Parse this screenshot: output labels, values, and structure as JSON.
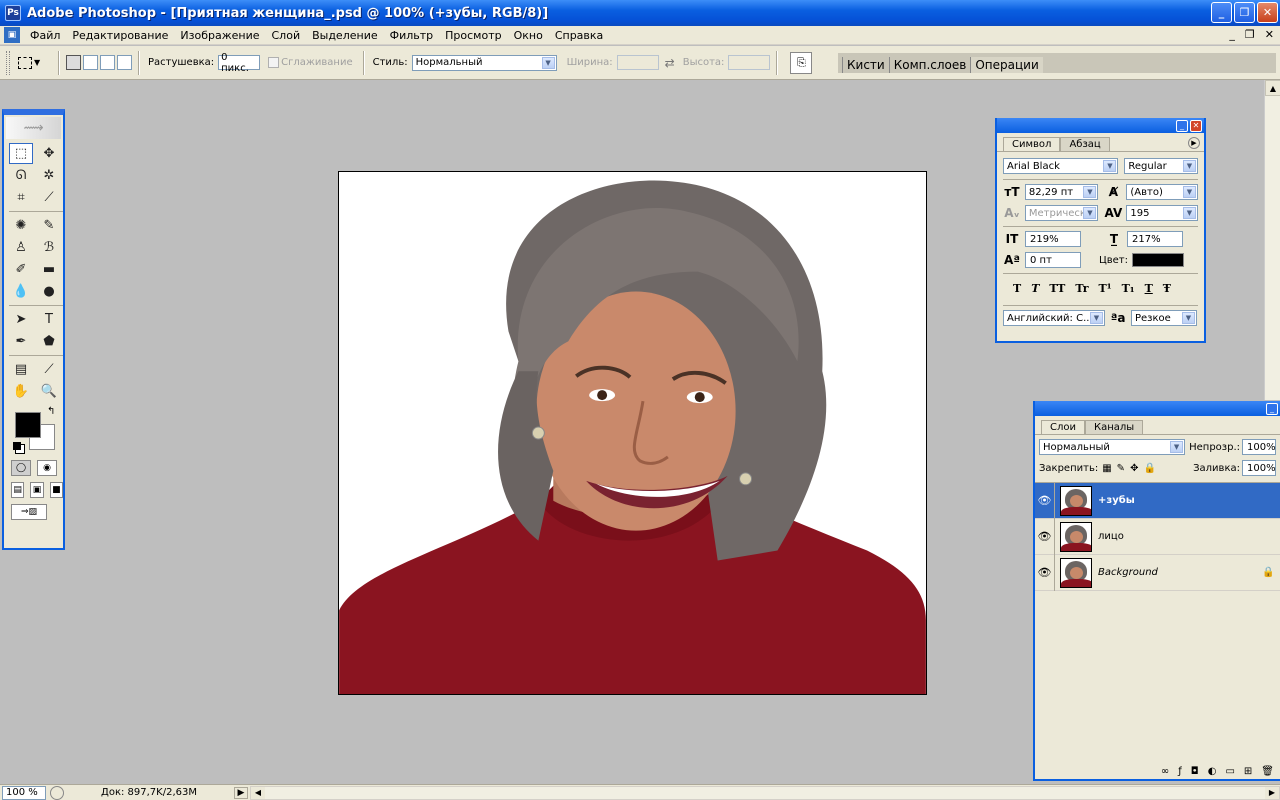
{
  "window": {
    "title": "Adobe Photoshop - [Приятная женщина_.psd @ 100% (+зубы, RGB/8)]",
    "app_icon": "Ps",
    "buttons": {
      "minimize": "_",
      "restore": "❐",
      "close": "✕"
    }
  },
  "menu": {
    "items": [
      "Файл",
      "Редактирование",
      "Изображение",
      "Слой",
      "Выделение",
      "Фильтр",
      "Просмотр",
      "Окно",
      "Справка"
    ],
    "doc_controls": [
      "_",
      "❐",
      "✕"
    ]
  },
  "options": {
    "feather_label": "Растушевка:",
    "feather_value": "0 пикс.",
    "antialias_label": "Сглаживание",
    "style_label": "Стиль:",
    "style_value": "Нормальный",
    "width_label": "Ширина:",
    "height_label": "Высота:"
  },
  "palette_well": {
    "tabs": [
      "Кисти",
      "Комп.слоев",
      "Операции"
    ]
  },
  "tools": {
    "icons": [
      "marquee-icon",
      "move-icon",
      "lasso-icon",
      "magic-wand-icon",
      "crop-icon",
      "slice-icon",
      "healing-icon",
      "brush-icon",
      "stamp-icon",
      "history-brush-icon",
      "eraser-icon",
      "gradient-icon",
      "blur-icon",
      "dodge-icon",
      "path-select-icon",
      "type-icon",
      "pen-icon",
      "shape-icon",
      "notes-icon",
      "eyedropper-icon",
      "hand-icon",
      "zoom-icon"
    ],
    "glyphs": [
      "⬚",
      "✥",
      "ᘏ",
      "✲",
      "⌗",
      "⟋",
      "✺",
      "✎",
      "♙",
      "ℬ",
      "✐",
      "▬",
      "💧",
      "●",
      "➤",
      "T",
      "✒",
      "⬟",
      "▤",
      "⟋",
      "✋",
      "🔍"
    ],
    "foreground": "#000000",
    "background": "#ffffff"
  },
  "character": {
    "tabs": [
      "Символ",
      "Абзац"
    ],
    "font_family": "Arial Black",
    "font_style": "Regular",
    "font_size": "82,29 пт",
    "leading": "(Авто)",
    "kerning": "Метрически",
    "tracking": "195",
    "vertical_scale": "219%",
    "horizontal_scale": "217%",
    "baseline_shift": "0 пт",
    "color_label": "Цвет:",
    "color": "#000000",
    "style_buttons": [
      "T",
      "T",
      "TT",
      "Tr",
      "T¹",
      "T₁",
      "T",
      "Ŧ"
    ],
    "language": "Английский: С...",
    "antialias": "Резкое",
    "aa_icon": "ªa"
  },
  "layers": {
    "tabs": [
      "Слои",
      "Каналы"
    ],
    "blend_mode": "Нормальный",
    "opacity_label": "Непрозр.:",
    "opacity": "100%",
    "lock_label": "Закрепить:",
    "fill_label": "Заливка:",
    "fill": "100%",
    "items": [
      {
        "name": "+зубы",
        "selected": true,
        "italic": false,
        "locked": false
      },
      {
        "name": "лицо",
        "selected": false,
        "italic": false,
        "locked": false
      },
      {
        "name": "Background",
        "selected": false,
        "italic": true,
        "locked": true
      }
    ],
    "footer_icons": [
      "∞",
      "ƒ",
      "◘",
      "◐",
      "▭",
      "⊞",
      "🗑"
    ]
  },
  "status": {
    "zoom": "100 %",
    "doc_info": "Док: 897,7K/2,63M"
  }
}
